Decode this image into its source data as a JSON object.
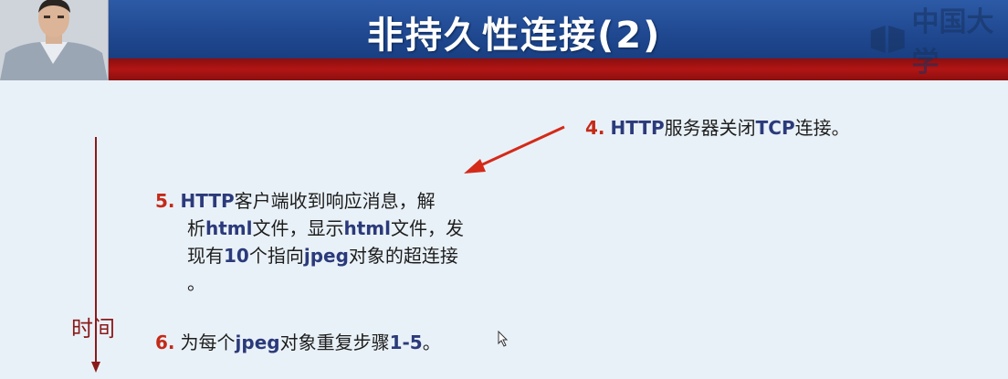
{
  "slide": {
    "title": "非持久性连接(2)",
    "logo_text": "中国大学",
    "time_label": "时间"
  },
  "steps": [
    {
      "number": "4.",
      "segments": [
        "HTTP",
        "服务器关闭",
        "TCP",
        "连接。"
      ]
    },
    {
      "number": "5.",
      "lines": [
        [
          "HTTP",
          "客户端收到响应消息，解"
        ],
        [
          "析",
          "html",
          "文件，显示",
          "html",
          "文件，发"
        ],
        [
          "现有",
          "10",
          "个指向",
          "jpeg",
          "对象的超连接"
        ],
        [
          "。"
        ]
      ]
    },
    {
      "number": "6.",
      "segments": [
        "为每个",
        "jpeg",
        "对象重复步骤",
        "1-5",
        "。"
      ]
    }
  ],
  "colors": {
    "header_blue": "#1f4890",
    "header_red": "#b31515",
    "step_number": "#c42a17",
    "arrow_red": "#d42a1a",
    "time_axis": "#8a1a1a"
  }
}
